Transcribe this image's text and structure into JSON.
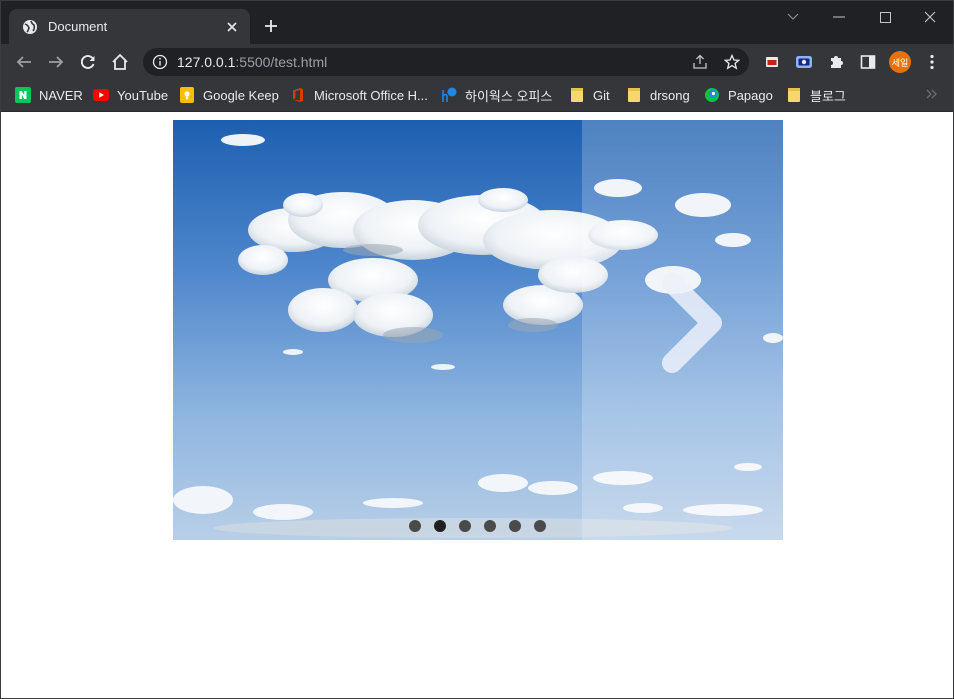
{
  "browser": {
    "tab_title": "Document",
    "url_host": "127.0.0.1",
    "url_rest": ":5500/test.html",
    "profile_initials": "세일"
  },
  "bookmarks": [
    {
      "label": "NAVER",
      "icon": "naver-icon"
    },
    {
      "label": "YouTube",
      "icon": "youtube-icon"
    },
    {
      "label": "Google Keep",
      "icon": "keep-icon"
    },
    {
      "label": "Microsoft Office H...",
      "icon": "office-icon"
    },
    {
      "label": "하이웍스 오피스",
      "icon": "hiworks-icon"
    },
    {
      "label": "Git",
      "icon": "folder-icon"
    },
    {
      "label": "drsong",
      "icon": "folder-icon"
    },
    {
      "label": "Papago",
      "icon": "papago-icon"
    },
    {
      "label": "블로그",
      "icon": "folder-icon"
    }
  ],
  "slider": {
    "slide_count": 6,
    "active_index": 1,
    "slide_image": "sky-clouds"
  },
  "colors": {
    "chrome_dark": "#202124",
    "chrome_toolbar": "#35363a",
    "avatar": "#e8710a",
    "dot": "#4a4a4a",
    "dot_active": "#202020"
  }
}
